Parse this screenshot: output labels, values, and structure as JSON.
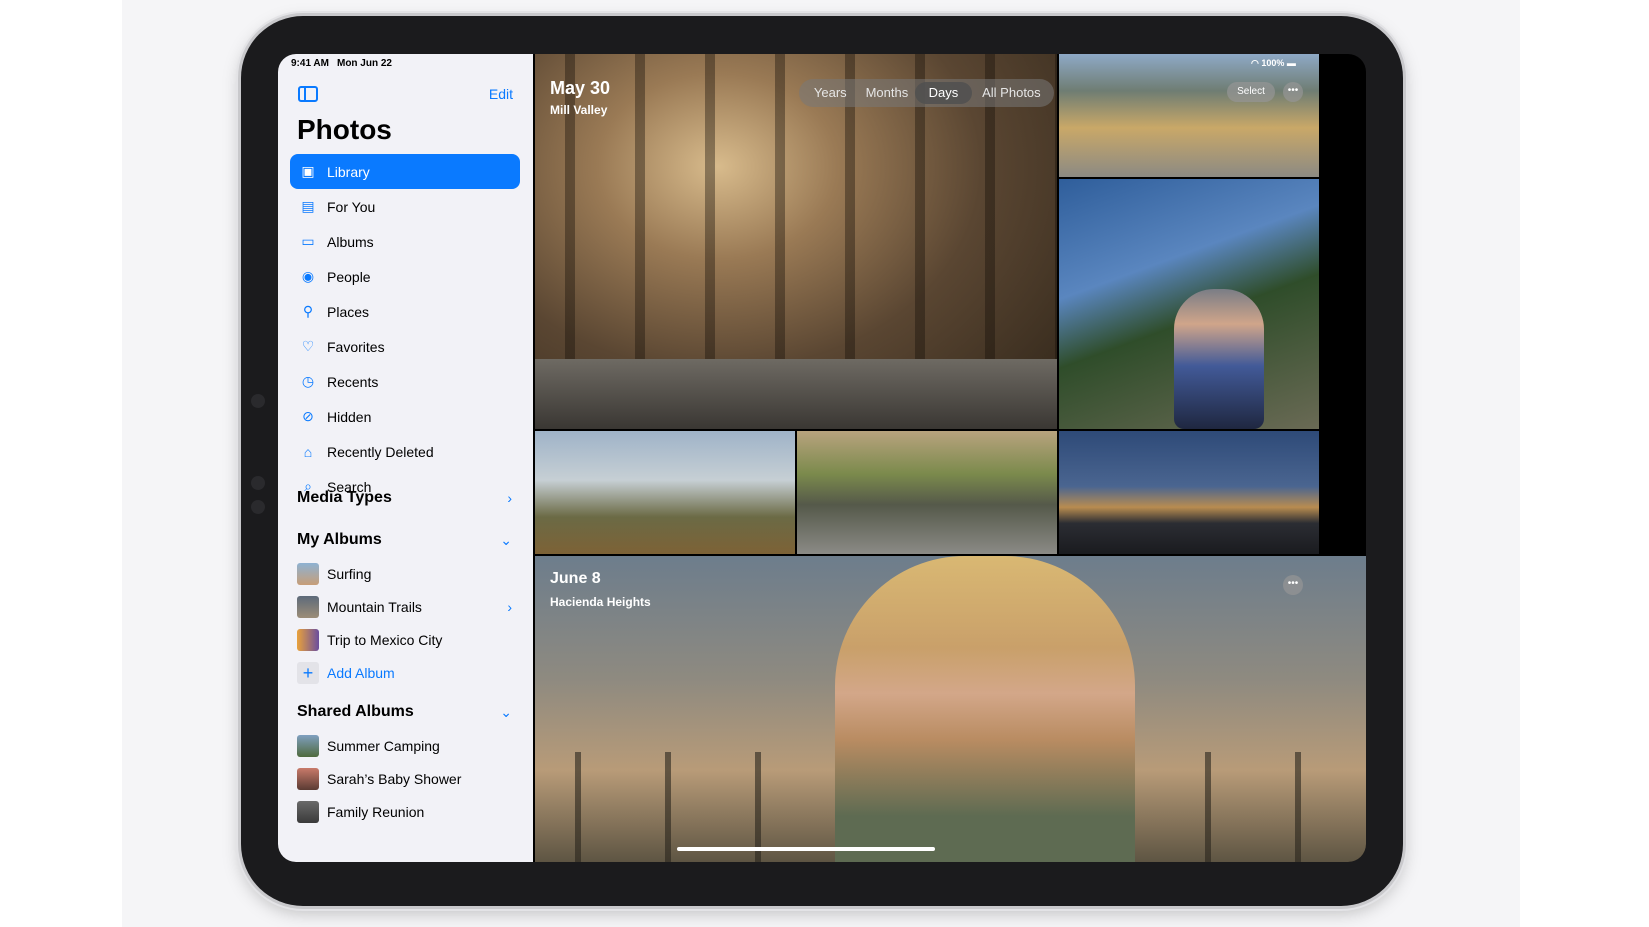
{
  "status": {
    "time": "9:41 AM",
    "date": "Mon Jun 22",
    "battery": "100%"
  },
  "sidebar": {
    "edit": "Edit",
    "title": "Photos",
    "items": [
      {
        "label": "Library",
        "icon": "library-icon",
        "glyph": "▣"
      },
      {
        "label": "For You",
        "icon": "for-you-icon",
        "glyph": "▤"
      },
      {
        "label": "Albums",
        "icon": "albums-icon",
        "glyph": "▭"
      },
      {
        "label": "People",
        "icon": "people-icon",
        "glyph": "◉"
      },
      {
        "label": "Places",
        "icon": "places-icon",
        "glyph": "⚲"
      },
      {
        "label": "Favorites",
        "icon": "heart-icon",
        "glyph": "♡"
      },
      {
        "label": "Recents",
        "icon": "clock-icon",
        "glyph": "◷"
      },
      {
        "label": "Hidden",
        "icon": "hidden-eye-icon",
        "glyph": "⊘"
      },
      {
        "label": "Recently Deleted",
        "icon": "trash-icon",
        "glyph": "⌂"
      },
      {
        "label": "Search",
        "icon": "search-icon",
        "glyph": "⌕"
      }
    ],
    "media_types": "Media Types",
    "my_albums": {
      "title": "My Albums",
      "items": [
        "Surfing",
        "Mountain Trails",
        "Trip to Mexico City"
      ],
      "add": "Add Album"
    },
    "shared_albums": {
      "title": "Shared Albums",
      "items": [
        "Summer Camping",
        "Sarah’s Baby Shower",
        "Family Reunion"
      ]
    }
  },
  "main": {
    "section1": {
      "date": "May 30",
      "location": "Mill Valley"
    },
    "section2": {
      "date": "June 8",
      "location": "Hacienda Heights"
    },
    "segments": [
      "Years",
      "Months",
      "Days",
      "All Photos"
    ],
    "active_segment": "Days",
    "select": "Select",
    "more": "•••"
  },
  "colors": {
    "accent": "#0a7aff",
    "sidebar_bg": "#f2f2f7"
  }
}
